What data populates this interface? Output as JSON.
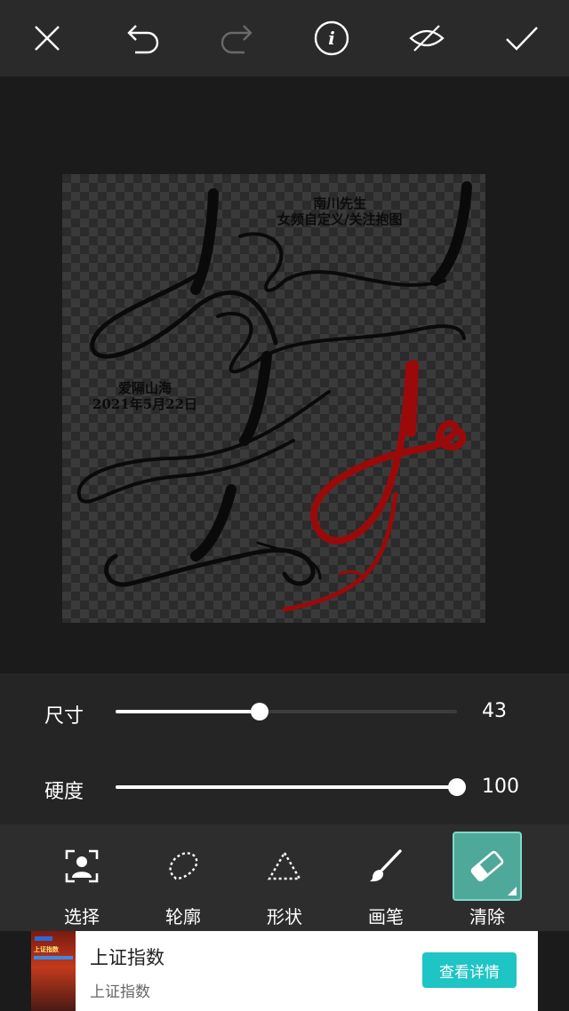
{
  "topbar": {
    "icons": [
      "close-icon",
      "undo-icon",
      "redo-icon",
      "info-icon",
      "hide-icon",
      "check-icon"
    ]
  },
  "artwork": {
    "text_top_line1": "南川先生",
    "text_top_line2": "女频自定义/关注抱图",
    "text_left_line1": "爱隔山海",
    "text_left_line2": "2021年5月22日",
    "ink_color": "#0a0a0a",
    "accent_color": "#9a0a0a"
  },
  "sliders": {
    "size": {
      "label": "尺寸",
      "value": "43",
      "fraction": 0.43
    },
    "hardness": {
      "label": "硬度",
      "value": "100",
      "fraction": 1.0
    }
  },
  "tools": [
    {
      "label": "选择",
      "icon": "select-person-icon"
    },
    {
      "label": "轮廓",
      "icon": "lasso-icon"
    },
    {
      "label": "形状",
      "icon": "shape-triangle-icon"
    },
    {
      "label": "画笔",
      "icon": "brush-icon"
    },
    {
      "label": "清除",
      "icon": "eraser-icon",
      "active": true
    }
  ],
  "ad": {
    "thumb_text": "上证指数",
    "title": "上证指数",
    "subtitle": "上证指数",
    "button": "查看详情",
    "button_color": "#1fc4c4"
  }
}
